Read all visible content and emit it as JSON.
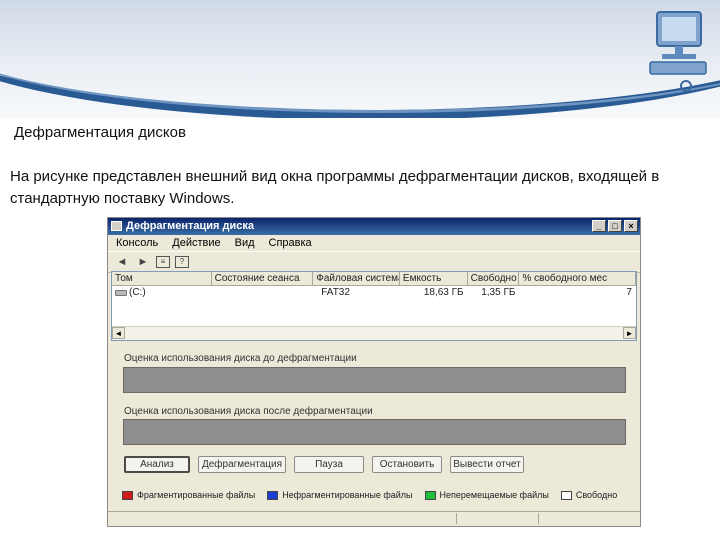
{
  "slide": {
    "title": "Дефрагментация дисков",
    "text": "На рисунке представлен внешний вид окна программы дефрагментации дисков, входящей в стандартную поставку Windows."
  },
  "window": {
    "title": "Дефрагментация диска",
    "menu": [
      "Консоль",
      "Действие",
      "Вид",
      "Справка"
    ],
    "toolbar_icons": [
      "back-icon",
      "forward-icon",
      "properties-icon",
      "help-icon"
    ],
    "columns": [
      "Том",
      "Состояние сеанса",
      "Файловая система",
      "Емкость",
      "Свободно",
      "% свободного мес"
    ],
    "rows": [
      {
        "volume": "(C:)",
        "status": "",
        "fs": "FAT32",
        "capacity": "18,63 ГБ",
        "free": "1,35 ГБ",
        "pct": "7"
      }
    ],
    "label_before": "Оценка использования диска до дефрагментации",
    "label_after": "Оценка использования диска после дефрагментации",
    "buttons": [
      "Анализ",
      "Дефрагментация",
      "Пауза",
      "Остановить",
      "Вывести отчет"
    ],
    "legend": [
      {
        "label": "Фрагментированные файлы",
        "color": "#d11a1a"
      },
      {
        "label": "Нефрагментированные файлы",
        "color": "#1a3fd1"
      },
      {
        "label": "Неперемещаемые файлы",
        "color": "#1fbf3a"
      },
      {
        "label": "Свободно",
        "color": "#ffffff"
      }
    ]
  }
}
